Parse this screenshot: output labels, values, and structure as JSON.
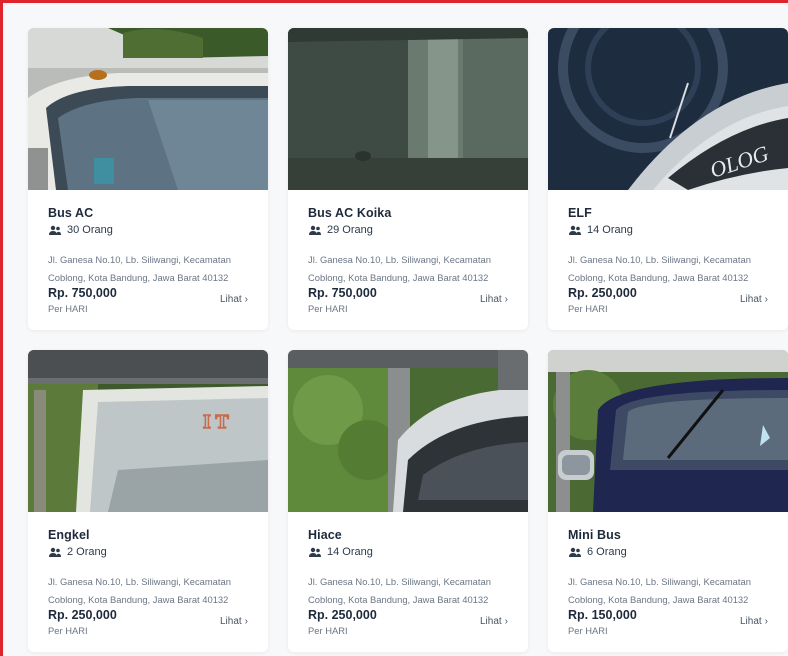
{
  "cards": [
    {
      "title": "Bus AC",
      "capacity": "30 Orang",
      "address": "Jl. Ganesa No.10, Lb. Siliwangi, Kecamatan Coblong, Kota Bandung, Jawa Barat 40132",
      "price": "Rp. 750,000",
      "per": "Per HARI",
      "link": "Lihat",
      "chevron": "›",
      "photo": "bus-ac-photo"
    },
    {
      "title": "Bus AC Koika",
      "capacity": "29 Orang",
      "address": "Jl. Ganesa No.10, Lb. Siliwangi, Kecamatan Coblong, Kota Bandung, Jawa Barat 40132",
      "price": "Rp. 750,000",
      "per": "Per HARI",
      "link": "Lihat",
      "chevron": "›",
      "photo": "bus-ac-koika-photo"
    },
    {
      "title": "ELF",
      "capacity": "14 Orang",
      "address": "Jl. Ganesa No.10, Lb. Siliwangi, Kecamatan Coblong, Kota Bandung, Jawa Barat 40132",
      "price": "Rp. 250,000",
      "per": "Per HARI",
      "link": "Lihat",
      "chevron": "›",
      "photo": "elf-photo"
    },
    {
      "title": "Engkel",
      "capacity": "2 Orang",
      "address": "Jl. Ganesa No.10, Lb. Siliwangi, Kecamatan Coblong, Kota Bandung, Jawa Barat 40132",
      "price": "Rp. 250,000",
      "per": "Per HARI",
      "link": "Lihat",
      "chevron": "›",
      "photo": "engkel-photo"
    },
    {
      "title": "Hiace",
      "capacity": "14 Orang",
      "address": "Jl. Ganesa No.10, Lb. Siliwangi, Kecamatan Coblong, Kota Bandung, Jawa Barat 40132",
      "price": "Rp. 250,000",
      "per": "Per HARI",
      "link": "Lihat",
      "chevron": "›",
      "photo": "hiace-photo"
    },
    {
      "title": "Mini Bus",
      "capacity": "6 Orang",
      "address": "Jl. Ganesa No.10, Lb. Siliwangi, Kecamatan Coblong, Kota Bandung, Jawa Barat 40132",
      "price": "Rp. 150,000",
      "per": "Per HARI",
      "link": "Lihat",
      "chevron": "›",
      "photo": "mini-bus-photo"
    }
  ],
  "colors": {
    "frame_border": "#e0242b",
    "card_bg": "#ffffff",
    "page_bg": "#f7f8fa",
    "title": "#1e2a3b",
    "muted": "#6b7685"
  }
}
